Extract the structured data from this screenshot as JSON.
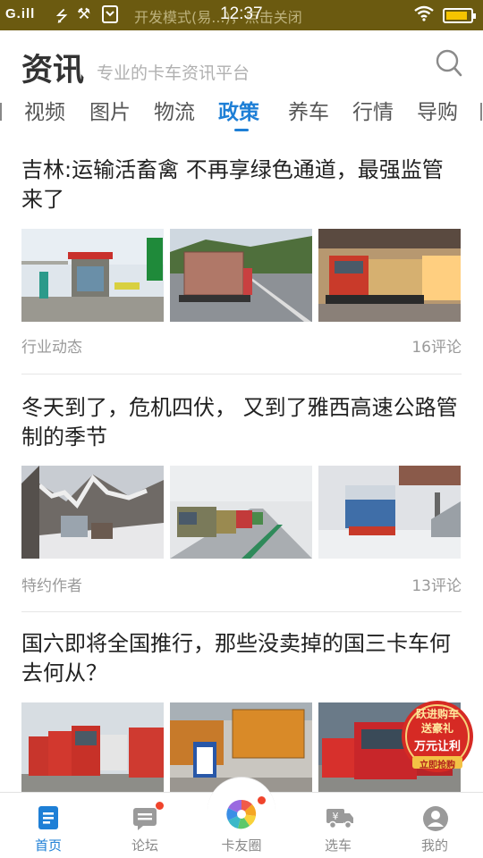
{
  "status_bar": {
    "signal": "G.ill",
    "notice": "开发模式(易...)，点击关闭",
    "time": "12:37",
    "battery_level_percent": 90
  },
  "header": {
    "title": "资讯",
    "slogan": "专业的卡车资讯平台"
  },
  "tabs": [
    "视频",
    "图片",
    "物流",
    "政策",
    "养车",
    "行情",
    "导购"
  ],
  "active_tab": "政策",
  "articles": [
    {
      "title": "吉林:运输活畜禽 不再享绿色通道，最强监管来了",
      "source": "行业动态",
      "comments": "16评论",
      "images": [
        "toll-station-photo",
        "livestock-truck-highway-photo",
        "red-truck-warehouse-photo"
      ]
    },
    {
      "title": "冬天到了，危机四伏， 又到了雅西高速公路管制的季节",
      "source": "特约作者",
      "comments": "13评论",
      "images": [
        "snowy-mountain-road-photo",
        "truck-queue-snow-highway-photo",
        "covered-truck-snow-photo"
      ]
    },
    {
      "title": "国六即将全国推行，那些没卖掉的国三卡车何去何从？",
      "source": "",
      "comments": "",
      "images": [
        "red-tractor-trucks-lot-photo",
        "orange-dump-trucks-photo",
        "red-truck-dealership-photo"
      ]
    }
  ],
  "promo": {
    "line1": "跃进购车",
    "line2": "送豪礼",
    "line3": "万元让利",
    "line4": "立即抢购"
  },
  "bottom_nav": [
    {
      "label": "首页",
      "icon": "news-icon",
      "active": true
    },
    {
      "label": "论坛",
      "icon": "forum-icon",
      "active": false
    },
    {
      "label": "卡友圈",
      "icon": "pinwheel-icon",
      "active": false
    },
    {
      "label": "选车",
      "icon": "truck-price-icon",
      "active": false
    },
    {
      "label": "我的",
      "icon": "profile-icon",
      "active": false
    }
  ],
  "colors": {
    "accent": "#1e7fd6",
    "status_bar": "#6b5a10",
    "badge_red": "#f0442c"
  }
}
